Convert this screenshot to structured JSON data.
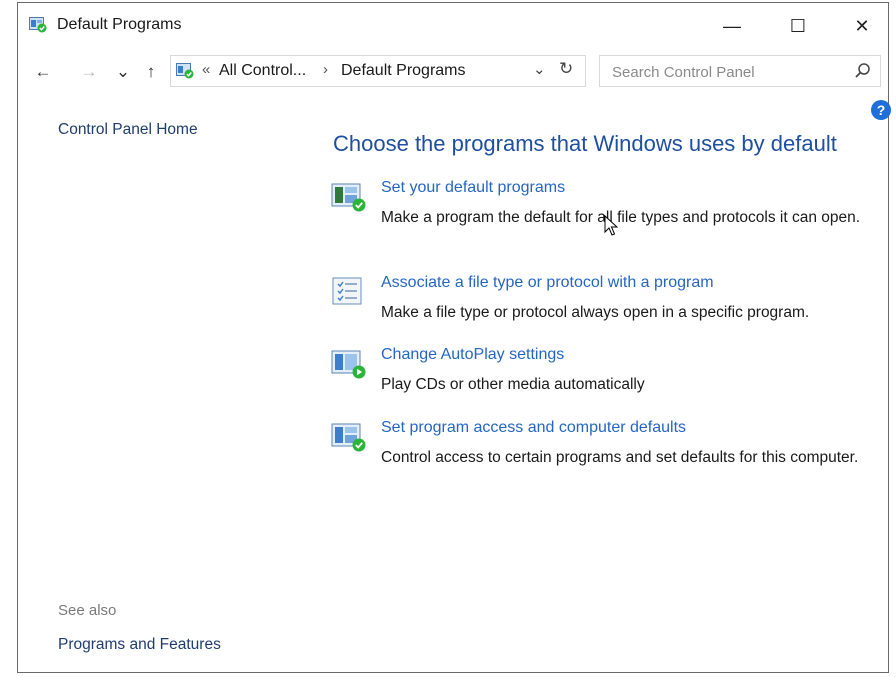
{
  "window": {
    "title": "Default Programs"
  },
  "titlebar": {
    "minimize": "—",
    "maximize": "☐",
    "close": "✕"
  },
  "nav": {
    "back": "←",
    "forward": "→",
    "recent": "⌄",
    "up": "↑",
    "breadcrumb_overflow": "«",
    "breadcrumbs": [
      "All Control...",
      "Default Programs"
    ],
    "separator": "›",
    "dropdown": "⌄",
    "refresh": "↻"
  },
  "search": {
    "placeholder": "Search Control Panel"
  },
  "help": {
    "label": "?"
  },
  "sidebar": {
    "home": "Control Panel Home",
    "see_also_label": "See also",
    "see_also_items": [
      "Programs and Features"
    ]
  },
  "main": {
    "heading": "Choose the programs that Windows uses by default",
    "tasks": [
      {
        "icon": "default-programs-icon",
        "link": "Set your default programs",
        "desc": "Make a program the default for all file types and protocols it can open."
      },
      {
        "icon": "associate-list-icon",
        "link": "Associate a file type or protocol with a program",
        "desc": "Make a file type or protocol always open in a specific program."
      },
      {
        "icon": "autoplay-icon",
        "link": "Change AutoPlay settings",
        "desc": "Play CDs or other media automatically"
      },
      {
        "icon": "program-access-icon",
        "link": "Set program access and computer defaults",
        "desc": "Control access to certain programs and set defaults for this computer."
      }
    ]
  },
  "colors": {
    "link": "#2566c4",
    "heading": "#1e4fa0",
    "nav_link": "#1f3d6e",
    "help": "#1e6fd9",
    "check": "#2bb33a"
  }
}
